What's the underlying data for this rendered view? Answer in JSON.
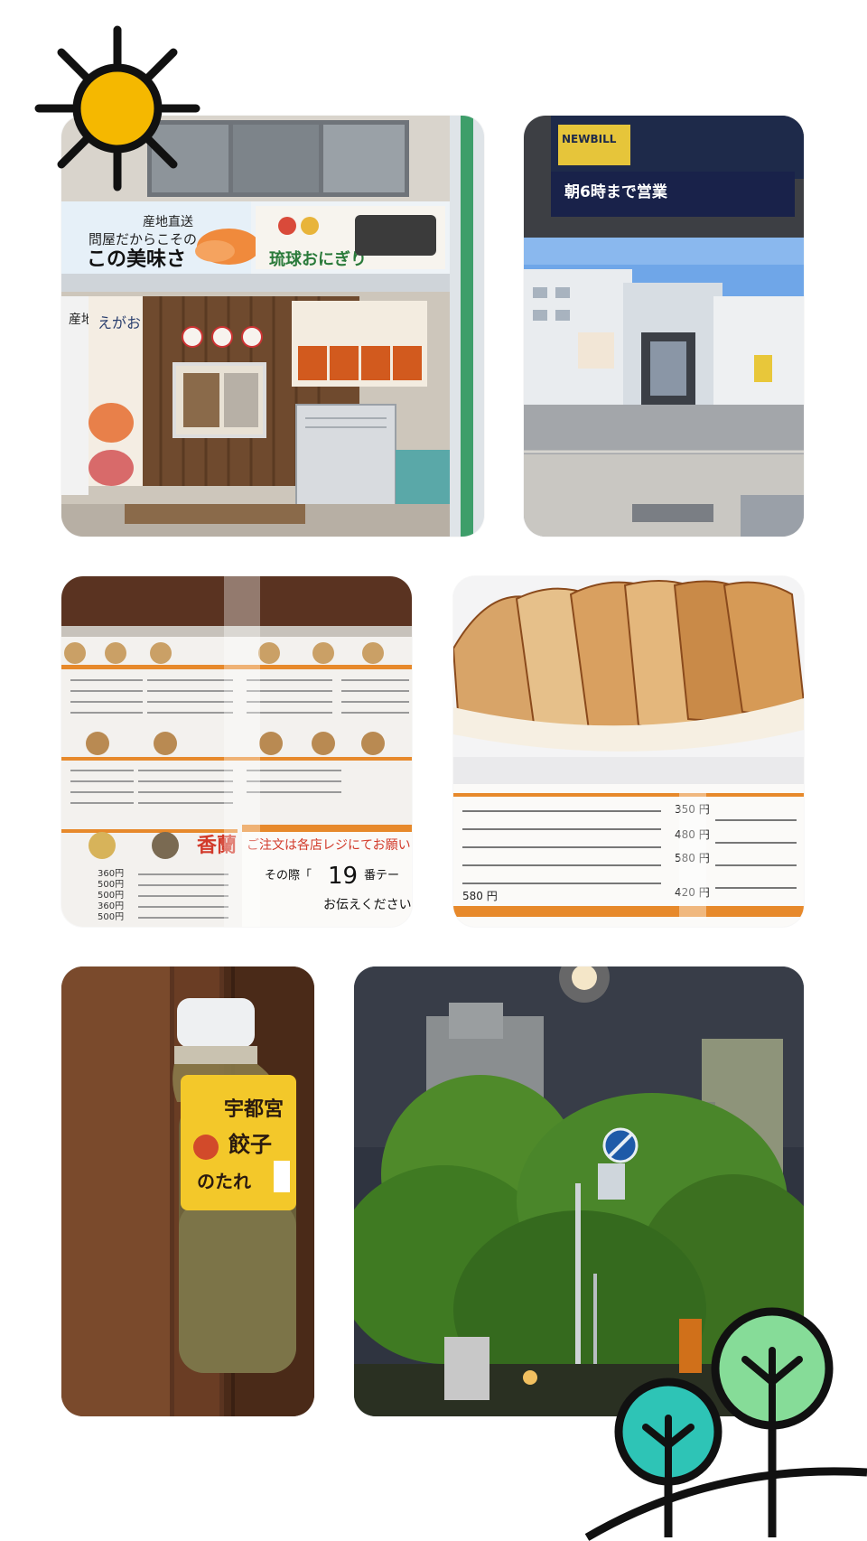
{
  "photo1": {
    "banner_line1": "産地直送",
    "banner_line2": "問屋だからこその",
    "banner_line3": "この美味さ",
    "onigiri_brand": "琉球おにぎり",
    "side_sign": "産地直送",
    "poster_name": "えがお"
  },
  "photo2": {
    "banner_top": "NEWBILL",
    "banner_text": "朝6時まで営業"
  },
  "photo3": {
    "brand": "香蘭",
    "order_notice": "ご注文は各店レジにてお願い",
    "number_prefix": "その際「",
    "number": "19",
    "number_suffix": "番テー",
    "closing": "お伝えください",
    "price1": "360円",
    "price2": "500円",
    "price3": "500円",
    "price4": "360円",
    "price5": "500円"
  },
  "photo4": {
    "price_a": "350 円",
    "price_b": "480 円",
    "price_c": "580 円",
    "price_d": "420 円",
    "price_e": "580 円"
  },
  "photo5": {
    "label_line1": "宇都宮",
    "label_line2": "餃子",
    "label_line3": "のたれ"
  }
}
